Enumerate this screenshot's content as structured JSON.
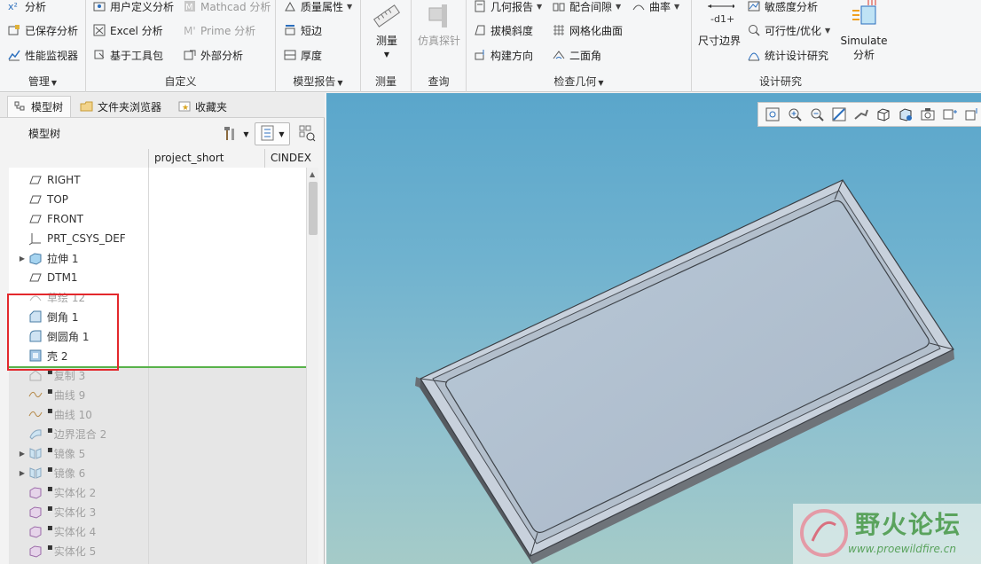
{
  "ribbon": {
    "groups": {
      "manage": {
        "label": "管理",
        "items": [
          "分析",
          "已保存分析",
          "性能监视器"
        ]
      },
      "custom": {
        "label": "自定义",
        "items": [
          "用户定义分析",
          "Mathcad 分析",
          "Excel 分析",
          "Prime 分析",
          "基于工具包",
          "外部分析"
        ]
      },
      "model_report": {
        "label": "模型报告",
        "items": [
          "质量属性",
          "短边",
          "厚度"
        ]
      },
      "measure": {
        "label": "测量",
        "button": "测量"
      },
      "query": {
        "label": "查询",
        "button": "仿真探针"
      },
      "inspect_geometry": {
        "label": "检查几何",
        "items": [
          "几何报告",
          "配合间隙",
          "曲率",
          "拔模斜度",
          "网格化曲面",
          "构建方向",
          "二面角"
        ]
      },
      "design_study": {
        "label": "设计研究",
        "dimension_button": "尺寸边界",
        "dimension_icon_text": "-d1+",
        "items": [
          "敏感度分析",
          "可行性/优化",
          "统计设计研究"
        ],
        "simulate_button": [
          "Simulate",
          "分析"
        ]
      }
    }
  },
  "panel": {
    "tabs": [
      "模型树",
      "文件夹浏览器",
      "收藏夹"
    ],
    "tree_title": "模型树",
    "columns": [
      "project_short",
      "CINDEX"
    ],
    "items": [
      {
        "label": "RIGHT",
        "icon": "datum-plane-icon",
        "expand": false,
        "faded": false,
        "star": false
      },
      {
        "label": "TOP",
        "icon": "datum-plane-icon",
        "expand": false,
        "faded": false,
        "star": false
      },
      {
        "label": "FRONT",
        "icon": "datum-plane-icon",
        "expand": false,
        "faded": false,
        "star": false
      },
      {
        "label": "PRT_CSYS_DEF",
        "icon": "csys-icon",
        "expand": false,
        "faded": false,
        "star": false
      },
      {
        "label": "拉伸 1",
        "icon": "extrude-icon",
        "expand": true,
        "faded": false,
        "star": false
      },
      {
        "label": "DTM1",
        "icon": "datum-plane-icon",
        "expand": false,
        "faded": false,
        "star": false
      },
      {
        "label": "草绘 12",
        "icon": "sketch-icon",
        "expand": false,
        "faded": true,
        "star": false
      },
      {
        "label": "倒角 1",
        "icon": "chamfer-icon",
        "expand": false,
        "faded": false,
        "star": false
      },
      {
        "label": "倒圆角 1",
        "icon": "round-icon",
        "expand": false,
        "faded": false,
        "star": false
      },
      {
        "label": "壳 2",
        "icon": "shell-icon",
        "expand": false,
        "faded": false,
        "star": false
      },
      {
        "label": "复制 3",
        "icon": "copy-icon",
        "expand": false,
        "faded": true,
        "star": true
      },
      {
        "label": "曲线 9",
        "icon": "curve-icon",
        "expand": false,
        "faded": true,
        "star": true
      },
      {
        "label": "曲线 10",
        "icon": "curve-icon",
        "expand": false,
        "faded": true,
        "star": true
      },
      {
        "label": "边界混合 2",
        "icon": "boundary-blend-icon",
        "expand": false,
        "faded": true,
        "star": true
      },
      {
        "label": "镜像 5",
        "icon": "mirror-icon",
        "expand": true,
        "faded": true,
        "star": true
      },
      {
        "label": "镜像 6",
        "icon": "mirror-icon",
        "expand": true,
        "faded": true,
        "star": true
      },
      {
        "label": "实体化 2",
        "icon": "solidify-icon",
        "expand": false,
        "faded": true,
        "star": true
      },
      {
        "label": "实体化 3",
        "icon": "solidify-icon",
        "expand": false,
        "faded": true,
        "star": true
      },
      {
        "label": "实体化 4",
        "icon": "solidify-icon",
        "expand": false,
        "faded": true,
        "star": true
      },
      {
        "label": "实体化 5",
        "icon": "solidify-icon",
        "expand": false,
        "faded": true,
        "star": true
      }
    ]
  },
  "viewport": {
    "toolbar_icons": [
      "zoom-fit-icon",
      "zoom-in-icon",
      "zoom-out-icon",
      "reorient-icon",
      "view-manager-icon",
      "display-style-icon",
      "saved-views-icon",
      "render-icon",
      "datum-display-icon",
      "spin-center-icon"
    ]
  },
  "watermark": {
    "title": "野火论坛",
    "url": "www.proewildfire.cn"
  }
}
